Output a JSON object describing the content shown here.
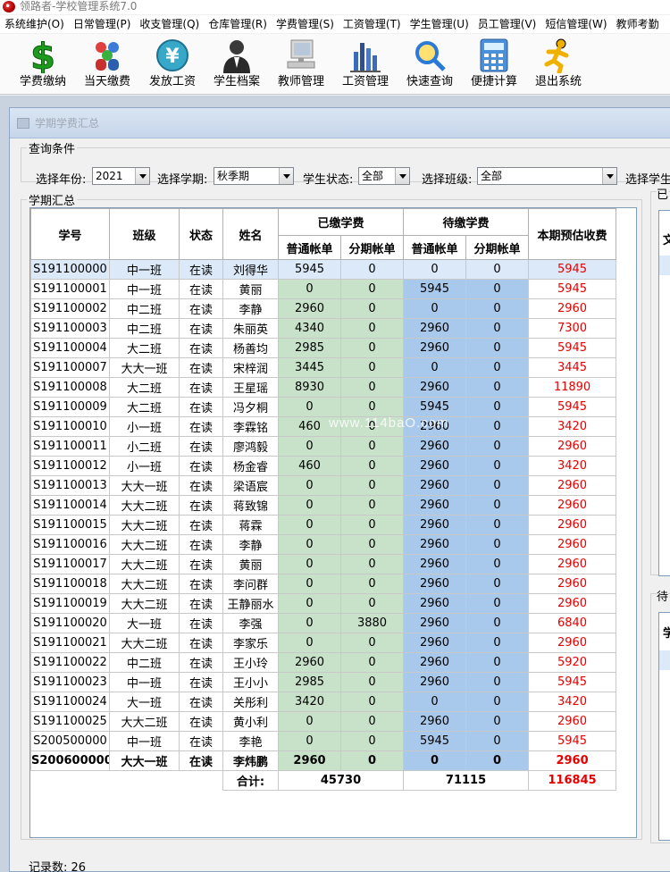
{
  "window": {
    "title": "领路者-学校管理系统7.0"
  },
  "menu": [
    "系统维护(O)",
    "日常管理(P)",
    "收支管理(Q)",
    "仓库管理(R)",
    "学费管理(S)",
    "工资管理(T)",
    "学生管理(U)",
    "员工管理(V)",
    "短信管理(W)",
    "教师考勤"
  ],
  "toolbar": [
    {
      "label": "学费缴纳",
      "icon": "dollar-icon"
    },
    {
      "label": "当天缴费",
      "icon": "people-icon"
    },
    {
      "label": "发放工资",
      "icon": "yen-coin-icon"
    },
    {
      "label": "学生档案",
      "icon": "person-icon"
    },
    {
      "label": "教师管理",
      "icon": "computer-icon"
    },
    {
      "label": "工资管理",
      "icon": "bar-chart-icon"
    },
    {
      "label": "快速查询",
      "icon": "magnifier-icon"
    },
    {
      "label": "便捷计算",
      "icon": "calculator-icon"
    },
    {
      "label": "退出系统",
      "icon": "running-man-icon"
    }
  ],
  "subwindow": {
    "title": "学期学费汇总"
  },
  "query": {
    "legend": "查询条件",
    "year_label": "选择年份:",
    "year_value": "2021",
    "term_label": "选择学期:",
    "term_value": "秋季期",
    "status_label": "学生状态:",
    "status_value": "全部",
    "class_label": "选择班级:",
    "class_value": "全部",
    "student_label": "选择学生"
  },
  "summary": {
    "legend": "学期汇总",
    "headers": {
      "id": "学号",
      "class": "班级",
      "status": "状态",
      "name": "姓名",
      "paid": "已缴学费",
      "pending": "待缴学费",
      "normal": "普通帐单",
      "installment": "分期帐单",
      "estimate": "本期预估收费"
    },
    "rows": [
      [
        "S191100000",
        "中一班",
        "在读",
        "刘得华",
        "5945",
        "0",
        "0",
        "0",
        "5945"
      ],
      [
        "S191100001",
        "中一班",
        "在读",
        "黄丽",
        "0",
        "0",
        "5945",
        "0",
        "5945"
      ],
      [
        "S191100002",
        "中二班",
        "在读",
        "李静",
        "2960",
        "0",
        "0",
        "0",
        "2960"
      ],
      [
        "S191100003",
        "中二班",
        "在读",
        "朱丽英",
        "4340",
        "0",
        "2960",
        "0",
        "7300"
      ],
      [
        "S191100004",
        "大二班",
        "在读",
        "杨善均",
        "2985",
        "0",
        "2960",
        "0",
        "5945"
      ],
      [
        "S191100007",
        "大大一班",
        "在读",
        "宋梓润",
        "3445",
        "0",
        "0",
        "0",
        "3445"
      ],
      [
        "S191100008",
        "大二班",
        "在读",
        "王星瑶",
        "8930",
        "0",
        "2960",
        "0",
        "11890"
      ],
      [
        "S191100009",
        "大二班",
        "在读",
        "冯夕桐",
        "0",
        "0",
        "5945",
        "0",
        "5945"
      ],
      [
        "S191100010",
        "小一班",
        "在读",
        "李霖铭",
        "460",
        "0",
        "2960",
        "0",
        "3420"
      ],
      [
        "S191100011",
        "小二班",
        "在读",
        "廖鸿毅",
        "0",
        "0",
        "2960",
        "0",
        "2960"
      ],
      [
        "S191100012",
        "小一班",
        "在读",
        "杨金睿",
        "460",
        "0",
        "2960",
        "0",
        "3420"
      ],
      [
        "S191100013",
        "大大一班",
        "在读",
        "梁语宸",
        "0",
        "0",
        "2960",
        "0",
        "2960"
      ],
      [
        "S191100014",
        "大大二班",
        "在读",
        "蒋致锦",
        "0",
        "0",
        "2960",
        "0",
        "2960"
      ],
      [
        "S191100015",
        "大大二班",
        "在读",
        "蒋霖",
        "0",
        "0",
        "2960",
        "0",
        "2960"
      ],
      [
        "S191100016",
        "大大二班",
        "在读",
        "李静",
        "0",
        "0",
        "2960",
        "0",
        "2960"
      ],
      [
        "S191100017",
        "大大二班",
        "在读",
        "黄丽",
        "0",
        "0",
        "2960",
        "0",
        "2960"
      ],
      [
        "S191100018",
        "大大二班",
        "在读",
        "李问群",
        "0",
        "0",
        "2960",
        "0",
        "2960"
      ],
      [
        "S191100019",
        "大大二班",
        "在读",
        "王静丽水",
        "0",
        "0",
        "2960",
        "0",
        "2960"
      ],
      [
        "S191100020",
        "大一班",
        "在读",
        "李强",
        "0",
        "3880",
        "2960",
        "0",
        "6840"
      ],
      [
        "S191100021",
        "大大二班",
        "在读",
        "李家乐",
        "0",
        "0",
        "2960",
        "0",
        "2960"
      ],
      [
        "S191100022",
        "中二班",
        "在读",
        "王小玲",
        "2960",
        "0",
        "2960",
        "0",
        "5920"
      ],
      [
        "S191100023",
        "中一班",
        "在读",
        "王小小",
        "2985",
        "0",
        "2960",
        "0",
        "5945"
      ],
      [
        "S191100024",
        "大一班",
        "在读",
        "关彤利",
        "3420",
        "0",
        "0",
        "0",
        "3420"
      ],
      [
        "S191100025",
        "大大二班",
        "在读",
        "黄小利",
        "0",
        "0",
        "2960",
        "0",
        "2960"
      ],
      [
        "S200500000",
        "中一班",
        "在读",
        "李艳",
        "0",
        "0",
        "5945",
        "0",
        "5945"
      ],
      [
        "S200600000",
        "大大一班",
        "在读",
        "李炜鹏",
        "2960",
        "0",
        "0",
        "0",
        "2960"
      ]
    ],
    "total_label": "合计:",
    "total_paid": "45730",
    "total_pending": "71115",
    "total_estimate": "116845"
  },
  "side": {
    "legend1": "已",
    "header1": "文",
    "legend2": "待",
    "header2": "学"
  },
  "status": {
    "text": "记录数: 26"
  },
  "watermark": "www.114baO.com"
}
